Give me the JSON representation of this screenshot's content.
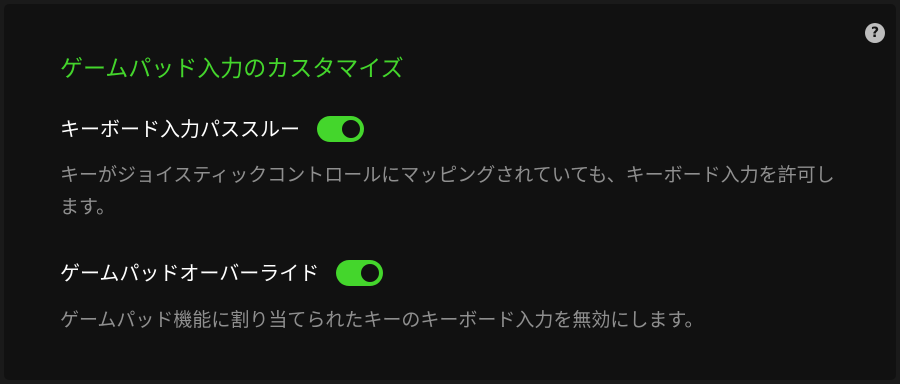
{
  "panel": {
    "help_icon": "?",
    "title": "ゲームパッド入力のカスタマイズ",
    "settings": [
      {
        "label": "キーボード入力パススルー",
        "enabled": true,
        "description": "キーがジョイスティックコントロールにマッピングされていても、キーボード入力を許可します。"
      },
      {
        "label": "ゲームパッドオーバーライド",
        "enabled": true,
        "description": "ゲームパッド機能に割り当てられたキーのキーボード入力を無効にします。"
      }
    ]
  },
  "colors": {
    "accent": "#44d62c",
    "background": "#111111",
    "text": "#ffffff",
    "muted_text": "#8f8f8f"
  }
}
